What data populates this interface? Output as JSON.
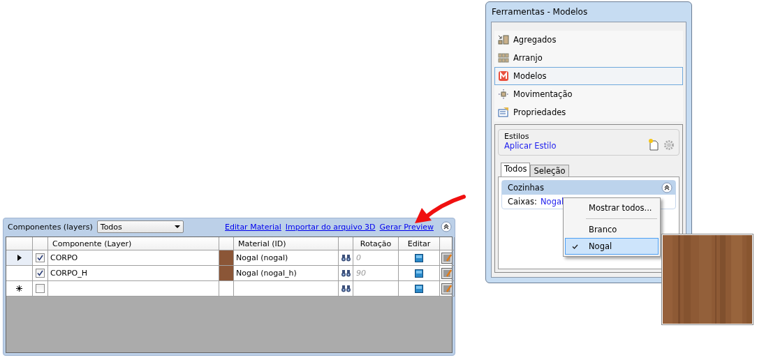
{
  "components_panel": {
    "label": "Componentes (layers)",
    "filter": {
      "value": "Todos"
    },
    "links": [
      "Editar Material",
      "Importar do arquivo 3D",
      "Gerar Preview"
    ],
    "grid": {
      "columns": [
        "Componente (Layer)",
        "Material (ID)",
        "Rotação",
        "Editar"
      ],
      "rows": [
        {
          "kind": "data",
          "selected": true,
          "checked": true,
          "component": "CORPO",
          "color": "#8b5637",
          "material": "Nogal (nogal)",
          "rotation": "0"
        },
        {
          "kind": "data",
          "selected": false,
          "checked": true,
          "component": "CORPO_H",
          "color": "#8b5637",
          "material": "Nogal (nogal_h)",
          "rotation": "90"
        },
        {
          "kind": "new",
          "selected": false,
          "checked": false
        }
      ]
    }
  },
  "tools_window": {
    "title": "Ferramentas - Modelos",
    "nav_items": [
      {
        "kind": "aggregates",
        "label": "Agregados",
        "selected": false
      },
      {
        "kind": "arrangement",
        "label": "Arranjo",
        "selected": false
      },
      {
        "kind": "models",
        "label": "Modelos",
        "selected": true
      },
      {
        "kind": "movement",
        "label": "Movimentação",
        "selected": false
      },
      {
        "kind": "properties",
        "label": "Propriedades",
        "selected": false
      }
    ],
    "styles": {
      "title": "Estilos",
      "link": "Aplicar Estilo"
    },
    "tabs": [
      {
        "label": "Todos",
        "selected": true
      },
      {
        "label": "Seleção",
        "selected": false
      }
    ],
    "section": {
      "title": "Cozinhas",
      "field_label": "Caixas:",
      "field_value": "Nogal"
    }
  },
  "context_menu": [
    {
      "kind": "item",
      "label": "Mostrar todos...",
      "checked": false,
      "selected": false
    },
    {
      "kind": "separator"
    },
    {
      "kind": "item",
      "label": "Branco",
      "checked": false,
      "selected": false
    },
    {
      "kind": "item",
      "label": "Nogal",
      "checked": true,
      "selected": true
    }
  ]
}
